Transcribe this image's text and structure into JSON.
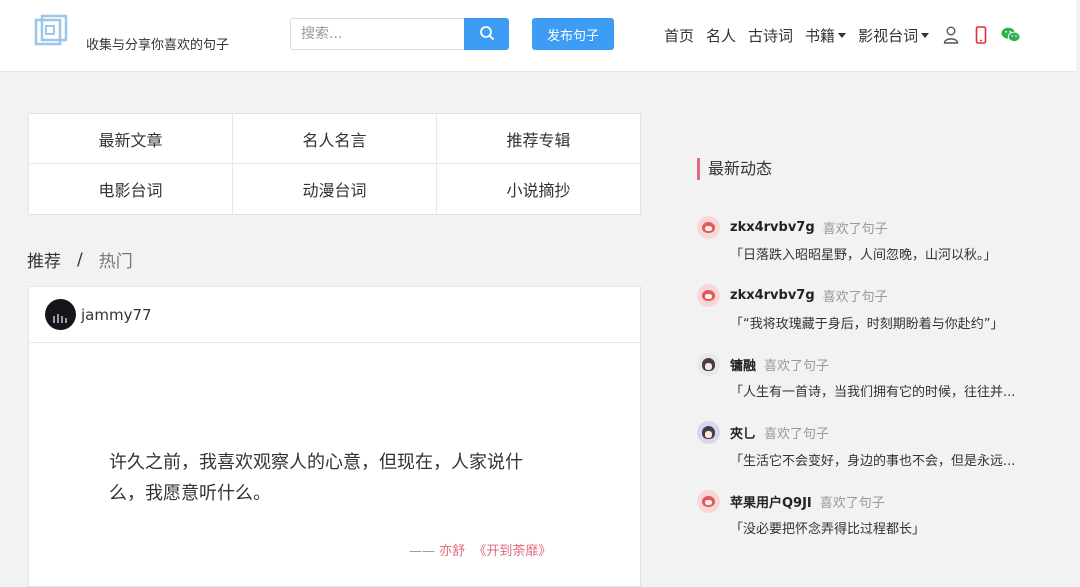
{
  "header": {
    "tagline": "收集与分享你喜欢的句子",
    "search": {
      "placeholder": "搜索..."
    },
    "publish_label": "发布句子",
    "nav": [
      {
        "label": "首页"
      },
      {
        "label": "名人"
      },
      {
        "label": "古诗词"
      },
      {
        "label": "书籍",
        "dropdown": true
      },
      {
        "label": "影视台词",
        "dropdown": true
      }
    ],
    "icons": [
      "user-icon",
      "mobile-icon",
      "wechat-icon"
    ],
    "accent": "#3d9df5"
  },
  "categories": [
    [
      "最新文章",
      "名人名言",
      "推荐专辑"
    ],
    [
      "电影台词",
      "动漫台词",
      "小说摘抄"
    ]
  ],
  "tabs": {
    "recommend": "推荐",
    "separator": "/",
    "hot": "热门"
  },
  "card": {
    "user": "jammy77",
    "quote": "许久之前，我喜欢观察人的心意，但现在，人家说什么，我愿意听什么。",
    "dash": "——",
    "author": "亦舒",
    "book": "《开到荼靡》",
    "source_color": "#e06a7d"
  },
  "feed": {
    "title": "最新动态",
    "items": [
      {
        "user": "zkx4rvbv7g",
        "action": "喜欢了句子",
        "text": "「日落跌入昭昭星野，人间忽晚，山河以秋。」",
        "avatar": "pink"
      },
      {
        "user": "zkx4rvbv7g",
        "action": "喜欢了句子",
        "text": "「“我将玫瑰藏于身后，时刻期盼着与你赴约”」",
        "avatar": "pink"
      },
      {
        "user": "镛融",
        "action": "喜欢了句子",
        "text": "「人生有一首诗，当我们拥有它的时候，往往并...",
        "avatar": "gray"
      },
      {
        "user": "夾乚",
        "action": "喜欢了句子",
        "text": "「生活它不会变好，身边的事也不会，但是永远...",
        "avatar": "purple"
      },
      {
        "user": "苹果用户Q9JI",
        "action": "喜欢了句子",
        "text": "「没必要把怀念弄得比过程都长」",
        "avatar": "pink"
      }
    ]
  }
}
